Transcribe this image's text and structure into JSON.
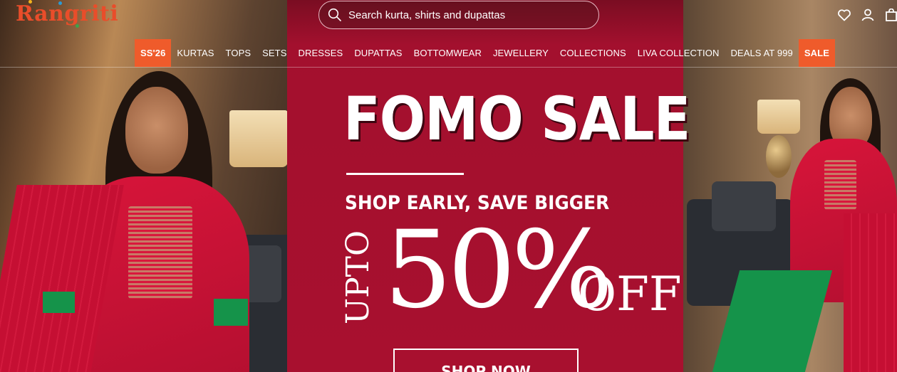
{
  "brand": {
    "logo_text": "Rangriti",
    "accent_color": "#ef5b2b"
  },
  "header": {
    "search": {
      "placeholder": "Search kurta, shirts and dupattas",
      "icon": "search-icon"
    },
    "icons": [
      "heart-icon",
      "user-icon",
      "bag-icon"
    ]
  },
  "nav": {
    "items": [
      {
        "label": "SS'26",
        "highlight": true
      },
      {
        "label": "KURTAS"
      },
      {
        "label": "TOPS"
      },
      {
        "label": "SETS"
      },
      {
        "label": "DRESSES"
      },
      {
        "label": "DUPATTAS"
      },
      {
        "label": "BOTTOMWEAR"
      },
      {
        "label": "JEWELLERY"
      },
      {
        "label": "COLLECTIONS"
      },
      {
        "label": "LIVA COLLECTION"
      },
      {
        "label": "DEALS AT 999"
      },
      {
        "label": "SALE",
        "highlight": true
      }
    ]
  },
  "banner": {
    "headline": "FOMO SALE",
    "tagline": "SHOP EARLY, SAVE BIGGER",
    "upto": "UPTO",
    "discount": "50%",
    "off": "OFF",
    "cta_label": "SHOP NOW",
    "background_color": "#a8102f"
  }
}
